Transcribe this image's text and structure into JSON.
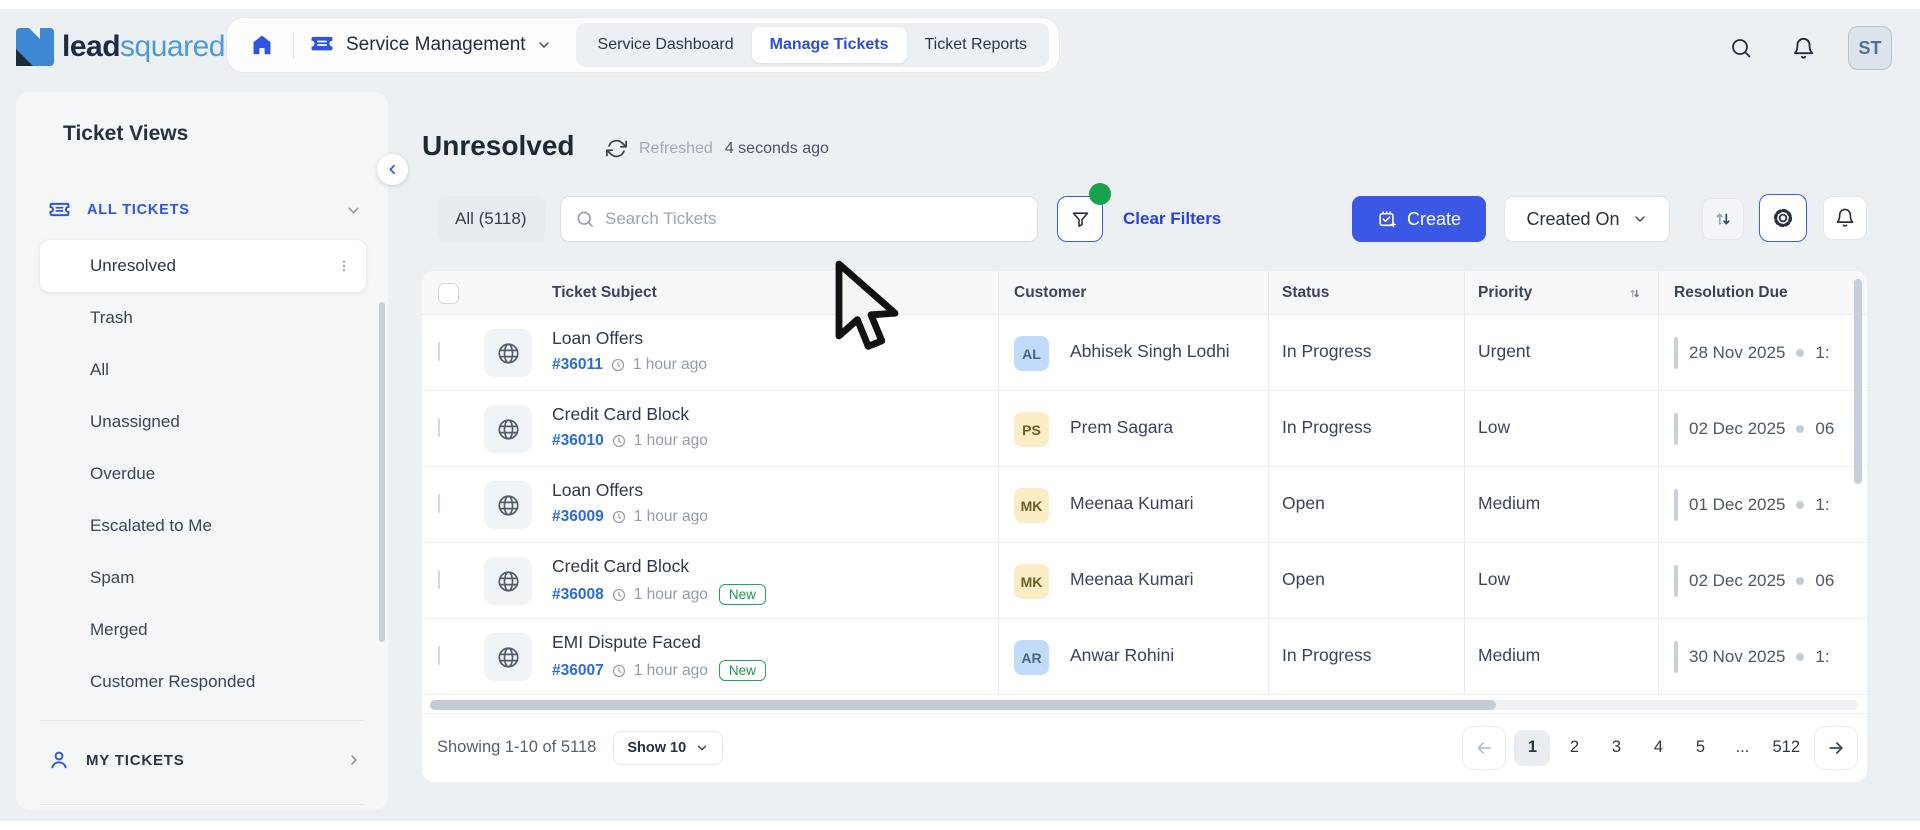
{
  "nav": {
    "logo_part1": "lead",
    "logo_part2": "squared",
    "app_switcher_label": "Service Management",
    "tabs": [
      {
        "label": "Service Dashboard",
        "active": false
      },
      {
        "label": "Manage Tickets",
        "active": true
      },
      {
        "label": "Ticket Reports",
        "active": false
      }
    ],
    "avatar_initials": "ST"
  },
  "sidebar": {
    "title": "Ticket Views",
    "group_label": "ALL TICKETS",
    "items": [
      "Unresolved",
      "Trash",
      "All",
      "Unassigned",
      "Overdue",
      "Escalated to Me",
      "Spam",
      "Merged",
      "Customer Responded"
    ],
    "selected_item": "Unresolved",
    "my_tickets_label": "MY TICKETS"
  },
  "header": {
    "title": "Unresolved",
    "refreshed_label": "Refreshed",
    "refreshed_ago": "4 seconds ago"
  },
  "toolbar": {
    "count_chip": "All (5118)",
    "search_placeholder": "Search Tickets",
    "clear_filters_label": "Clear Filters",
    "create_label": "Create",
    "sort_field": "Created On"
  },
  "table": {
    "columns": [
      "Ticket Subject",
      "Customer",
      "Status",
      "Priority",
      "Resolution Due"
    ],
    "new_badge": "New",
    "rows": [
      {
        "subject": "Loan Offers",
        "id": "#36011",
        "time": "1 hour ago",
        "new": false,
        "initials": "AL",
        "avatar_bg": "#c3dbfa",
        "avatar_fg": "#4e657e",
        "customer": "Abhisek Singh Lodhi",
        "status": "In Progress",
        "priority": "Urgent",
        "due_date": "28 Nov 2025",
        "due_time": "1:"
      },
      {
        "subject": "Credit Card Block",
        "id": "#36010",
        "time": "1 hour ago",
        "new": false,
        "initials": "PS",
        "avatar_bg": "#fbeec7",
        "avatar_fg": "#6e5b28",
        "customer": "Prem Sagara",
        "status": "In Progress",
        "priority": "Low",
        "due_date": "02 Dec 2025",
        "due_time": "06"
      },
      {
        "subject": "Loan Offers",
        "id": "#36009",
        "time": "1 hour ago",
        "new": false,
        "initials": "MK",
        "avatar_bg": "#fbeec7",
        "avatar_fg": "#6e5b28",
        "customer": "Meenaa Kumari",
        "status": "Open",
        "priority": "Medium",
        "due_date": "01 Dec 2025",
        "due_time": "1:"
      },
      {
        "subject": "Credit Card Block",
        "id": "#36008",
        "time": "1 hour ago",
        "new": true,
        "initials": "MK",
        "avatar_bg": "#fbeec7",
        "avatar_fg": "#6e5b28",
        "customer": "Meenaa Kumari",
        "status": "Open",
        "priority": "Low",
        "due_date": "02 Dec 2025",
        "due_time": "06"
      },
      {
        "subject": "EMI Dispute Faced",
        "id": "#36007",
        "time": "1 hour ago",
        "new": true,
        "initials": "AR",
        "avatar_bg": "#c3dbfa",
        "avatar_fg": "#4e657e",
        "customer": "Anwar Rohini",
        "status": "In Progress",
        "priority": "Medium",
        "due_date": "30 Nov 2025",
        "due_time": "1:"
      }
    ]
  },
  "pagination": {
    "showing": "Showing 1-10 of 5118",
    "page_size_label": "Show 10",
    "pages": [
      "1",
      "2",
      "3",
      "4",
      "5",
      "...",
      "512"
    ],
    "active_page": "1"
  },
  "colors": {
    "accent_blue": "#3b57e6",
    "link_blue": "#2a6bdb",
    "success_green": "#17a24b",
    "page_background": "#edf0f3"
  }
}
